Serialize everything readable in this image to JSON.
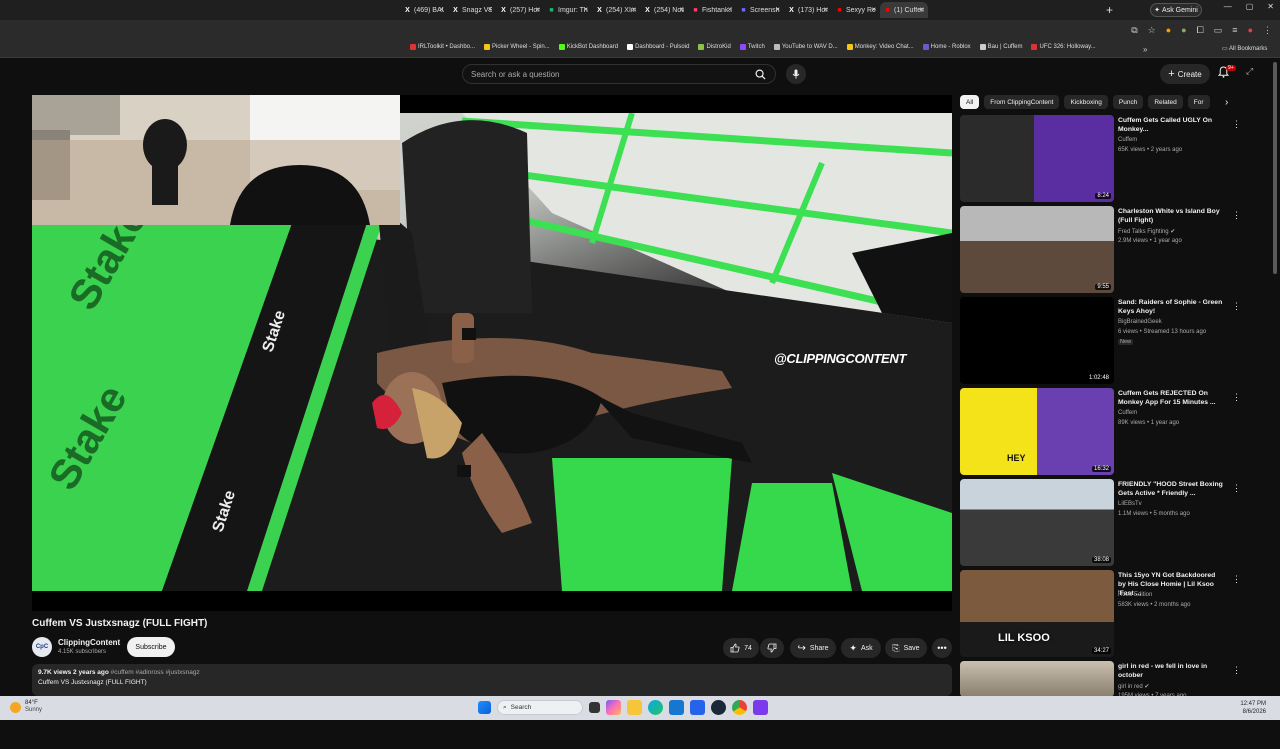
{
  "browser": {
    "tabs": [
      {
        "title": "(469) BAU",
        "icon": "x-icon",
        "color": "#ffffff"
      },
      {
        "title": "Snagz VS",
        "icon": "x-icon",
        "color": "#ffffff"
      },
      {
        "title": "(257) Hom",
        "icon": "x-icon",
        "color": "#ffffff"
      },
      {
        "title": "Imgur: The",
        "icon": "imgur-icon",
        "color": "#1bb76e"
      },
      {
        "title": "(254) XIm",
        "icon": "x-icon",
        "color": "#ffffff"
      },
      {
        "title": "(254) Noti",
        "icon": "x-icon",
        "color": "#ffffff"
      },
      {
        "title": "Fishtank.l",
        "icon": "fishtank-icon",
        "color": "#ff3b6b"
      },
      {
        "title": "Screensho",
        "icon": "screenshot-icon",
        "color": "#6b6bff"
      },
      {
        "title": "(173) Hom",
        "icon": "x-icon",
        "color": "#ffffff"
      },
      {
        "title": "Sexyy Red",
        "icon": "youtube-icon",
        "color": "#ff0000"
      },
      {
        "title": "(1) Cuffem",
        "icon": "youtube-icon",
        "color": "#ff0000"
      }
    ],
    "active_tab": 10,
    "new_tab": "+",
    "ask_gemini": "Ask Gemini",
    "bookmarks": [
      {
        "label": "IRLToolkit • Dashbo...",
        "color": "#d33"
      },
      {
        "label": "Picker Wheel - Spin...",
        "color": "#f5c518"
      },
      {
        "label": "KickBot Dashboard",
        "color": "#53fc18"
      },
      {
        "label": "Dashboard - Pulsoid",
        "color": "#ffffff"
      },
      {
        "label": "DistroKid",
        "color": "#8bc34a"
      },
      {
        "label": "Twitch",
        "color": "#9146ff"
      },
      {
        "label": "YouTube to WAV D...",
        "color": "#bbbbbb"
      },
      {
        "label": "Monkey: Video Chat...",
        "color": "#f5c518"
      },
      {
        "label": "Home - Roblox",
        "color": "#6a5acd"
      },
      {
        "label": "Bau | Cuffem",
        "color": "#cccccc"
      },
      {
        "label": "UFC 326: Holloway...",
        "color": "#d33"
      }
    ],
    "bookmarks_more": "»",
    "all_bookmarks": "All Bookmarks"
  },
  "youtube": {
    "search_placeholder": "Search or ask a question",
    "create_label": "Create",
    "notifications_count": "9+",
    "video": {
      "watermark": "@CLIPPINGCONTENT",
      "title": "Cuffem VS Justxsnagz (FULL FIGHT)",
      "channel": "ClippingContent",
      "subscribers": "4.15K subscribers",
      "subscribe_label": "Subscribe",
      "likes": "74",
      "share_label": "Share",
      "ask_label": "Ask",
      "save_label": "Save",
      "views_date": "9.7K views  2 years ago",
      "hashtags": "#cuffem #adinross #justxsnagz",
      "description": "Cuffem VS Justxsnagz (FULL FIGHT)",
      "avatar_text": "CpC"
    },
    "chips": [
      "All",
      "From ClippingContent",
      "Kickboxing",
      "Punch",
      "Related",
      "For"
    ],
    "recommendations": [
      {
        "title": "Cuffem Gets Called UGLY On Monkey...",
        "channel": "Cuffem",
        "meta": "65K views • 2 years ago",
        "duration": "8:24",
        "verified": false,
        "badge": ""
      },
      {
        "title": "Charleston White vs Island Boy (Full Fight)",
        "channel": "Fred Talks Fighting",
        "meta": "2.9M views • 1 year ago",
        "duration": "9:55",
        "verified": true,
        "badge": ""
      },
      {
        "title": "Sand: Raiders of Sophie - Green Keys Ahoy!",
        "channel": "BigBrainedGeek",
        "meta": "6 views • Streamed 13 hours ago",
        "duration": "1:02:48",
        "verified": false,
        "badge": "New"
      },
      {
        "title": "Cuffem Gets REJECTED On Monkey App For 15 Minutes ...",
        "channel": "Cuffem",
        "meta": "89K views • 1 year ago",
        "duration": "16:32",
        "verified": false,
        "badge": ""
      },
      {
        "title": "FRIENDLY \"HOOD Street Boxing Gets Active * Friendly ...",
        "channel": "LilEBsTv",
        "meta": "1.1M views • 5 months ago",
        "duration": "38:08",
        "verified": false,
        "badge": ""
      },
      {
        "title": "This 15yo YN Got Backdoored by His Close Homie | Lil Ksoo 'Fast ...",
        "channel": "Hood Edition",
        "meta": "583K views • 2 months ago",
        "duration": "34:27",
        "verified": false,
        "badge": ""
      },
      {
        "title": "girl in red - we fell in love in october",
        "channel": "girl in red",
        "meta": "195M views • 7 years ago",
        "duration": "",
        "verified": true,
        "badge": ""
      }
    ],
    "thumb_texts": {
      "hey": "HEY",
      "ksoo": "LIL KSOO"
    }
  },
  "taskbar": {
    "weather_temp": "84°F",
    "weather_cond": "Sunny",
    "search_label": "Search",
    "time": "12:47 PM",
    "date": "8/6/2026"
  }
}
